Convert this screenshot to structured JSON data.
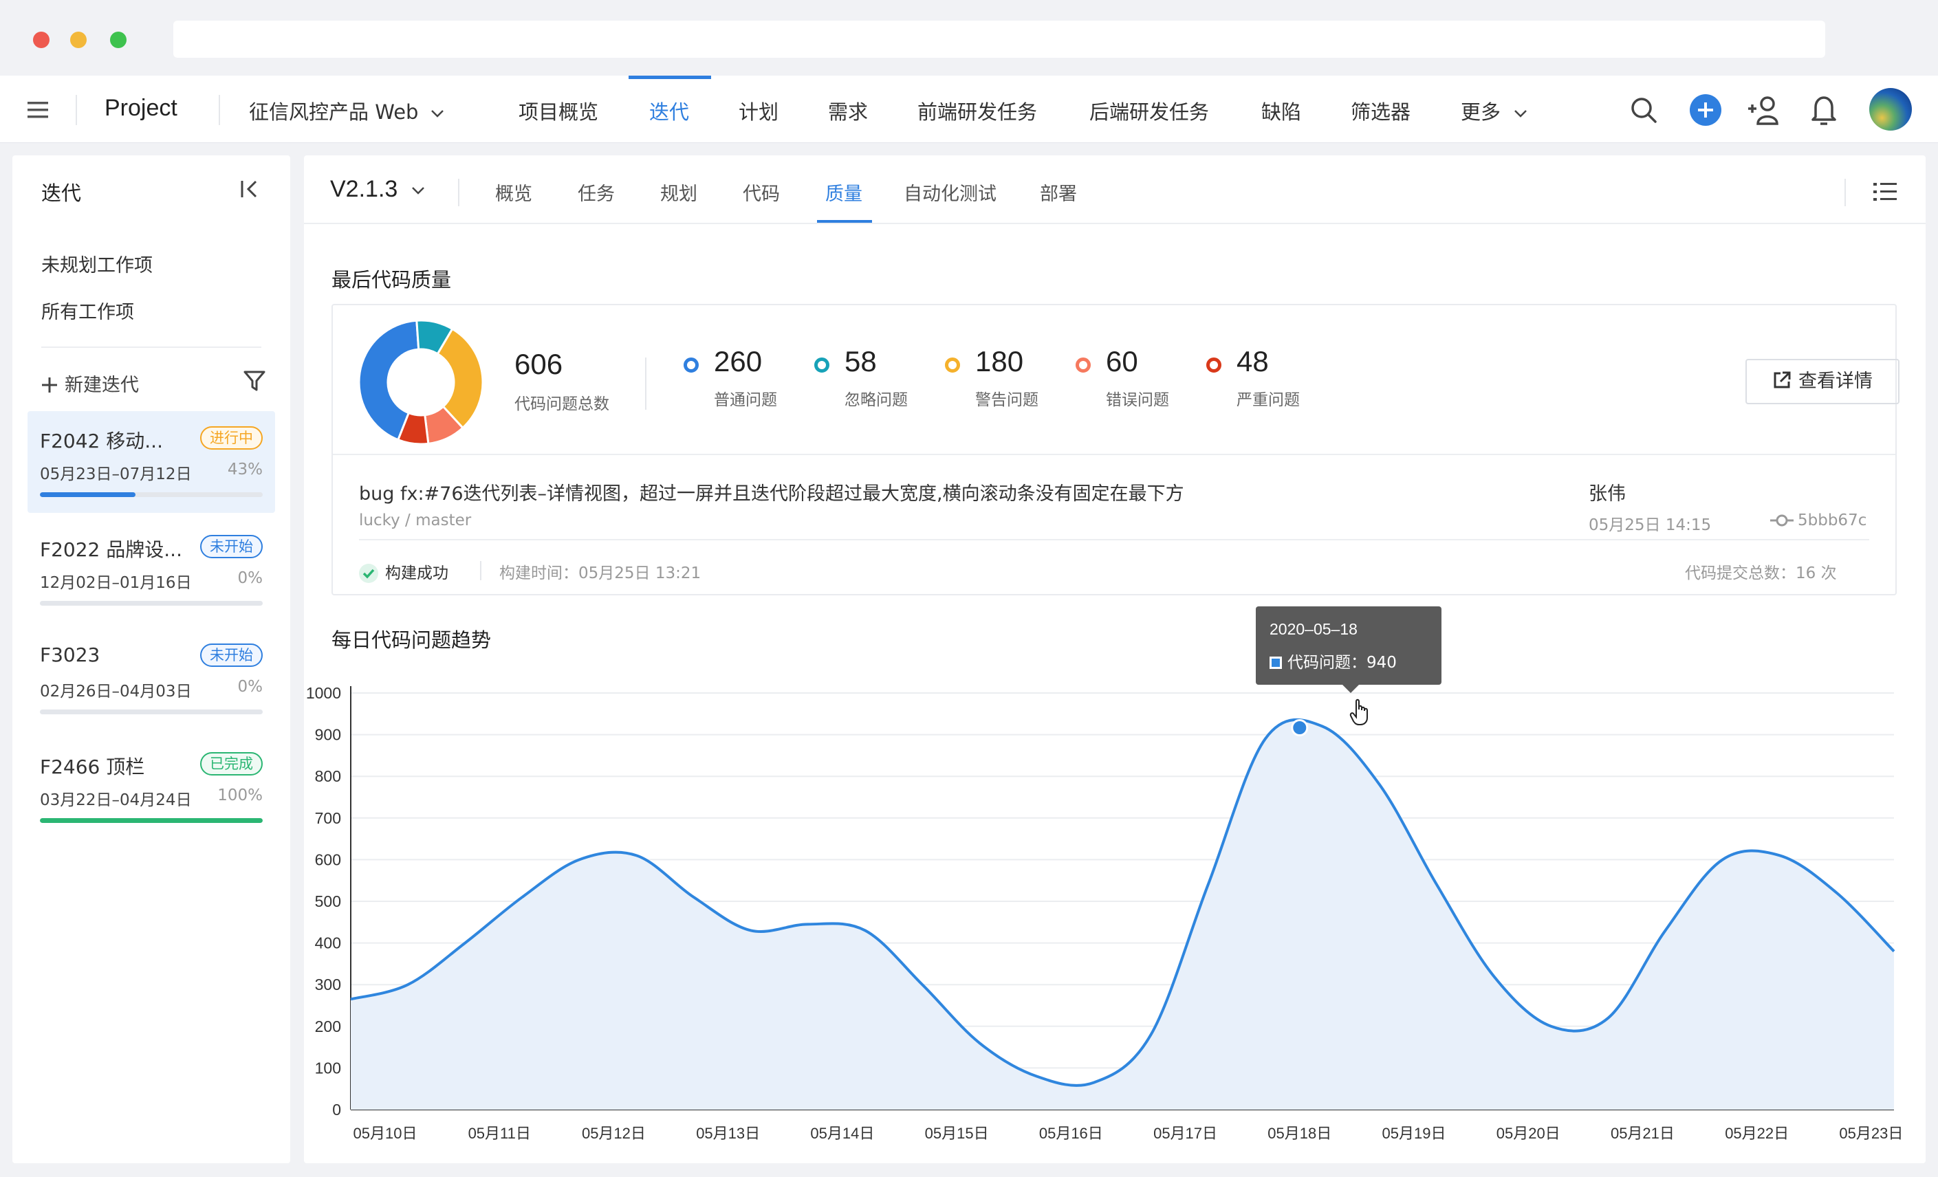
{
  "header": {
    "project_label": "Project",
    "product_name": "征信风控产品 Web",
    "nav": [
      "项目概览",
      "迭代",
      "计划",
      "需求",
      "前端研发任务",
      "后端研发任务",
      "缺陷",
      "筛选器",
      "更多"
    ],
    "active_nav": "迭代"
  },
  "sidebar": {
    "title": "迭代",
    "links": [
      "未规划工作项",
      "所有工作项"
    ],
    "new_iteration": "新建迭代",
    "iterations": [
      {
        "name": "F2042 移动...",
        "status": "进行中",
        "status_color": "#f5a623",
        "dates": "05月23日–07月12日",
        "progress": "43%",
        "progress_value": 0.43,
        "bar_color": "#2f7fdf"
      },
      {
        "name": "F2022 品牌设...",
        "status": "未开始",
        "status_color": "#2f7fdf",
        "dates": "12月02日–01月16日",
        "progress": "0%",
        "progress_value": 0,
        "bar_color": "#2f7fdf"
      },
      {
        "name": "F3023",
        "status": "未开始",
        "status_color": "#2f7fdf",
        "dates": "02月26日–04月03日",
        "progress": "0%",
        "progress_value": 0,
        "bar_color": "#2f7fdf"
      },
      {
        "name": "F2466 顶栏",
        "status": "已完成",
        "status_color": "#2bb673",
        "dates": "03月22日–04月24日",
        "progress": "100%",
        "progress_value": 1,
        "bar_color": "#2bb673"
      }
    ]
  },
  "main": {
    "version": "V2.1.3",
    "subtabs": [
      "概览",
      "任务",
      "规划",
      "代码",
      "质量",
      "自动化测试",
      "部署"
    ],
    "active_subtab": "质量",
    "quality_title": "最后代码质量",
    "total": {
      "value": "606",
      "label": "代码问题总数"
    },
    "stats": [
      {
        "value": "260",
        "label": "普通问题",
        "color": "#2f7fdf"
      },
      {
        "value": "58",
        "label": "忽略问题",
        "color": "#17a2b8"
      },
      {
        "value": "180",
        "label": "警告问题",
        "color": "#f5b12c"
      },
      {
        "value": "60",
        "label": "错误问题",
        "color": "#f6795e"
      },
      {
        "value": "48",
        "label": "严重问题",
        "color": "#d9391a"
      }
    ],
    "detail_button": "查看详情",
    "commit": {
      "message": "bug fx:#76迭代列表–详情视图，超过一屏并且迭代阶段超过最大宽度,横向滚动条没有固定在最下方",
      "repo": "lucky / master",
      "author": "张伟",
      "time": "05月25日 14:15",
      "hash": "5bbb67c",
      "build_status": "构建成功",
      "build_time": "构建时间：05月25日 13:21",
      "commit_count": "代码提交总数：16 次"
    },
    "trend_title": "每日代码问题趋势",
    "tooltip": {
      "date": "2020–05–18",
      "label": "代码问题：940"
    }
  },
  "chart_data": {
    "type": "area",
    "title": "每日代码问题趋势",
    "categories": [
      "05月10日",
      "05月11日",
      "05月12日",
      "05月13日",
      "05月14日",
      "05月15日",
      "05月16日",
      "05月17日",
      "05月18日",
      "05月19日",
      "05月20日",
      "05月21日",
      "05月22日",
      "05月23日"
    ],
    "x": [
      0,
      0.5,
      1,
      1.5,
      2,
      2.5,
      3,
      3.5,
      4,
      4.5,
      5,
      5.5,
      6,
      6.5,
      7,
      7.5,
      8,
      8.5,
      9,
      9.5,
      10,
      10.5,
      11,
      11.5,
      12,
      12.5,
      13,
      13.5
    ],
    "values": [
      265,
      300,
      400,
      510,
      600,
      610,
      510,
      430,
      445,
      430,
      300,
      160,
      80,
      65,
      180,
      540,
      890,
      920,
      780,
      540,
      320,
      200,
      220,
      430,
      600,
      610,
      520,
      380
    ],
    "highlight": {
      "category": "05月18日",
      "value": 940
    },
    "ylim": [
      0,
      1000
    ],
    "yticks": [
      0,
      100,
      200,
      300,
      400,
      500,
      600,
      700,
      800,
      900,
      1000
    ],
    "grid": true,
    "line_color": "#2f86de",
    "fill_color": "#e8f0fa"
  },
  "donut": {
    "values": [
      260,
      58,
      180,
      60,
      48
    ],
    "colors": [
      "#2f7fdf",
      "#17a2b8",
      "#f5b12c",
      "#f6795e",
      "#d9391a"
    ]
  }
}
